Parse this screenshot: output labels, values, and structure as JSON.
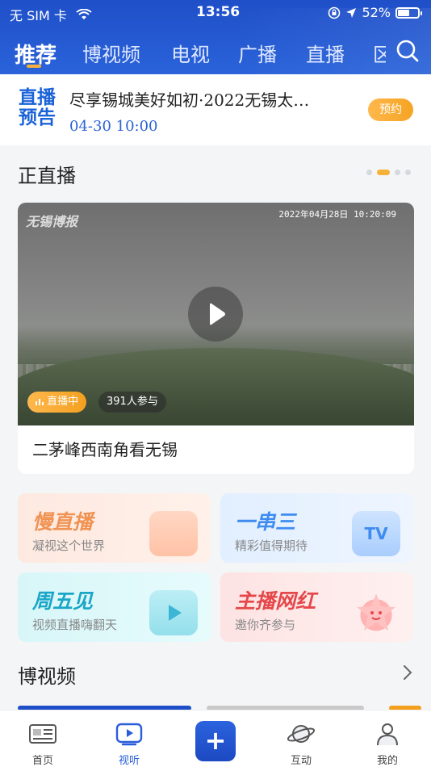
{
  "status_bar": {
    "carrier": "无 SIM 卡",
    "time": "13:56",
    "battery": "52%"
  },
  "tabs": [
    {
      "label": "推荐",
      "active": true
    },
    {
      "label": "博视频"
    },
    {
      "label": "电视"
    },
    {
      "label": "广播"
    },
    {
      "label": "直播"
    },
    {
      "label": "区"
    }
  ],
  "preview": {
    "logo_line1": "直播",
    "logo_line2": "预告",
    "title": "尽享锡城美好如初·2022无锡太…",
    "datetime": "04-30 10:00",
    "reserve_label": "预约"
  },
  "live_section": {
    "title": "正直播",
    "watermark": "无锡博报",
    "timestamp": "2022年04月28日 10:20:09",
    "live_badge": "直播中",
    "participants": "391人参与",
    "stream_title": "二茅峰西南角看无锡"
  },
  "categories": [
    {
      "title": "慢直播",
      "subtitle": "凝视这个世界"
    },
    {
      "title": "一串三",
      "subtitle": "精彩值得期待",
      "deco_text": "TV"
    },
    {
      "title": "周五见",
      "subtitle": "视频直播嗨翻天"
    },
    {
      "title": "主播网红",
      "subtitle": "邀你齐参与"
    }
  ],
  "video_section": {
    "title": "博视频"
  },
  "bottom_nav": [
    {
      "label": "首页"
    },
    {
      "label": "视听",
      "active": true
    },
    {
      "label": "+"
    },
    {
      "label": "互动"
    },
    {
      "label": "我的"
    }
  ],
  "colors": {
    "header_blue": "#2a5ddb",
    "accent_orange": "#f6b13a",
    "link_blue": "#2b63d5"
  }
}
